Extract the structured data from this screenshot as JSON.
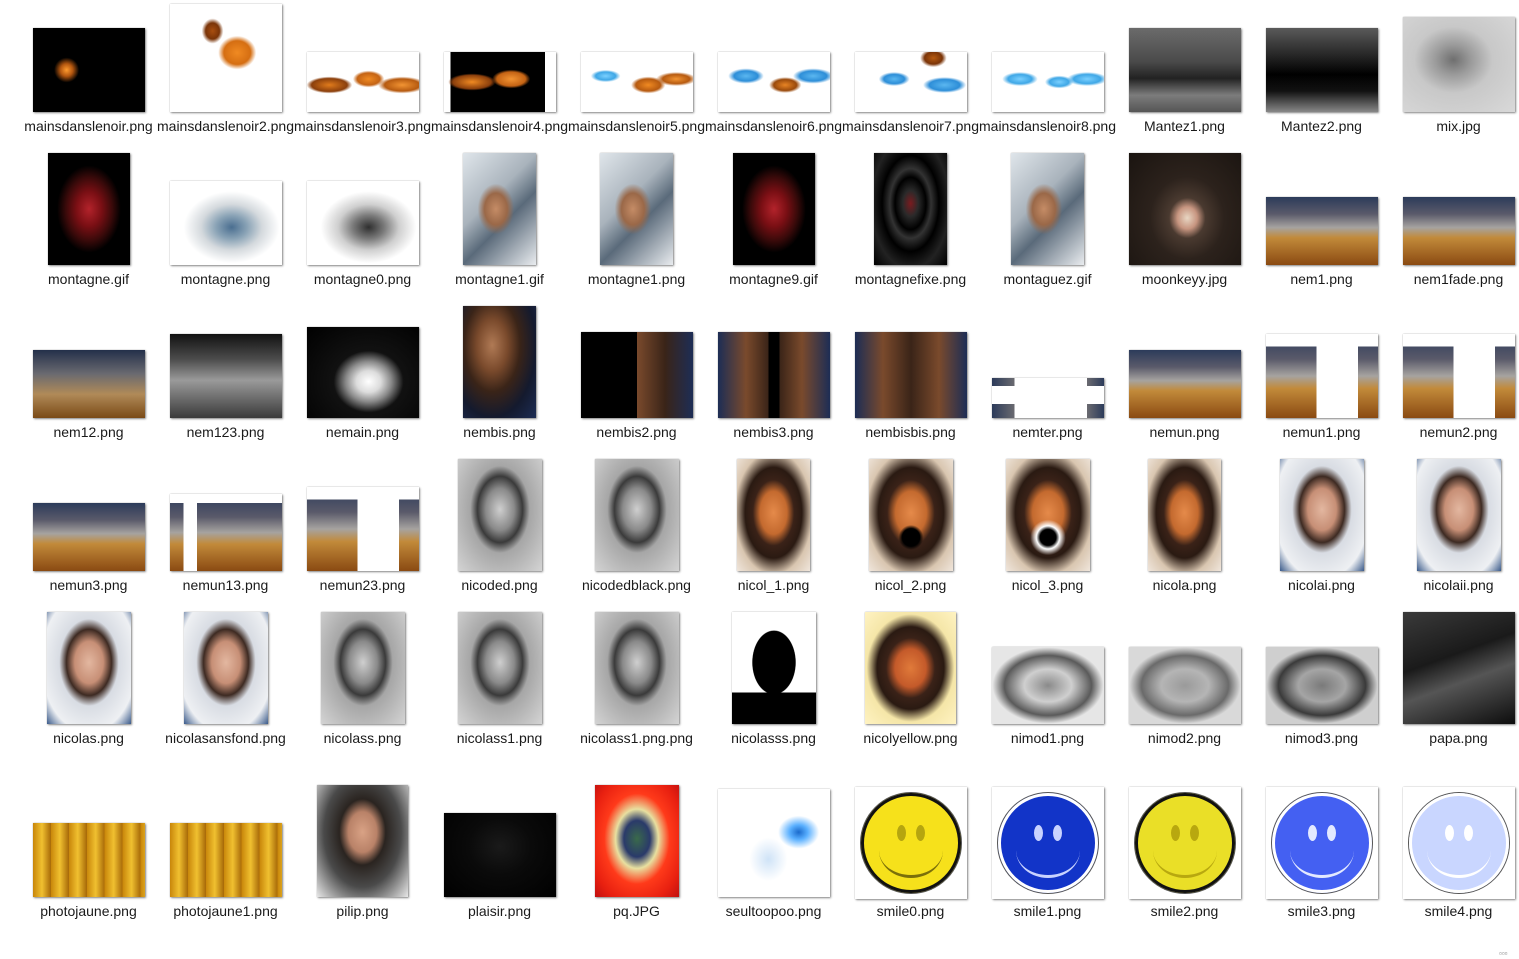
{
  "files": [
    {
      "name": "mainsdanslenoir.png",
      "thumb": "dark-hand"
    },
    {
      "name": "mainsdanslenoir2.png",
      "thumb": "orange-blob-white"
    },
    {
      "name": "mainsdanslenoir3.png",
      "thumb": "orange-hands-white"
    },
    {
      "name": "mainsdanslenoir4.png",
      "thumb": "orange-hands-black"
    },
    {
      "name": "mainsdanslenoir5.png",
      "thumb": "orange-blue-hands"
    },
    {
      "name": "mainsdanslenoir6.png",
      "thumb": "blue-hands"
    },
    {
      "name": "mainsdanslenoir7.png",
      "thumb": "blue-orange-hands"
    },
    {
      "name": "mainsdanslenoir8.png",
      "thumb": "blue-hands-light"
    },
    {
      "name": "Mantez1.png",
      "thumb": "gray-room"
    },
    {
      "name": "Mantez2.png",
      "thumb": "dark-room"
    },
    {
      "name": "mix.jpg",
      "thumb": "gray-mix"
    },
    {
      "name": "montagne.gif",
      "thumb": "heart"
    },
    {
      "name": "montagne.png",
      "thumb": "mountain"
    },
    {
      "name": "montagne0.png",
      "thumb": "mountain-gray"
    },
    {
      "name": "montagne1.gif",
      "thumb": "collage-figure"
    },
    {
      "name": "montagne1.png",
      "thumb": "collage-figure"
    },
    {
      "name": "montagne9.gif",
      "thumb": "heart"
    },
    {
      "name": "montagnefixe.png",
      "thumb": "dark-tunnel"
    },
    {
      "name": "montaguez.gif",
      "thumb": "collage-figure"
    },
    {
      "name": "moonkeyy.jpg",
      "thumb": "monkey"
    },
    {
      "name": "nem1.png",
      "thumb": "glass-table"
    },
    {
      "name": "nem1fade.png",
      "thumb": "glass-table"
    },
    {
      "name": "nem12.png",
      "thumb": "glass-table-blur"
    },
    {
      "name": "nem123.png",
      "thumb": "gray-blur"
    },
    {
      "name": "nemain.png",
      "thumb": "bw-hand"
    },
    {
      "name": "nembis.png",
      "thumb": "face-closeup"
    },
    {
      "name": "nembis2.png",
      "thumb": "face-half"
    },
    {
      "name": "nembis3.png",
      "thumb": "face-split"
    },
    {
      "name": "nembisbis.png",
      "thumb": "face-mirror"
    },
    {
      "name": "nemter.png",
      "thumb": "nemter"
    },
    {
      "name": "nemun.png",
      "thumb": "glass-table"
    },
    {
      "name": "nemun1.png",
      "thumb": "glass-table-rect"
    },
    {
      "name": "nemun2.png",
      "thumb": "glass-table-rect"
    },
    {
      "name": "nemun3.png",
      "thumb": "glass-table"
    },
    {
      "name": "nemun13.png",
      "thumb": "glass-table-cut"
    },
    {
      "name": "nemun23.png",
      "thumb": "glass-table-rect"
    },
    {
      "name": "nicoded.png",
      "thumb": "portrait-gray"
    },
    {
      "name": "nicodedblack.png",
      "thumb": "portrait-gray"
    },
    {
      "name": "nicol_1.png",
      "thumb": "portrait-orange"
    },
    {
      "name": "nicol_2.png",
      "thumb": "portrait-orange-mouth"
    },
    {
      "name": "nicol_3.png",
      "thumb": "portrait-orange-mouth2"
    },
    {
      "name": "nicola.png",
      "thumb": "portrait-orange"
    },
    {
      "name": "nicolai.png",
      "thumb": "portrait-color"
    },
    {
      "name": "nicolaii.png",
      "thumb": "portrait-color"
    },
    {
      "name": "nicolas.png",
      "thumb": "portrait-color"
    },
    {
      "name": "nicolasansfond.png",
      "thumb": "portrait-color"
    },
    {
      "name": "nicolass.png",
      "thumb": "portrait-gray"
    },
    {
      "name": "nicolass1.png",
      "thumb": "portrait-gray"
    },
    {
      "name": "nicolass1.png.png",
      "thumb": "portrait-gray"
    },
    {
      "name": "nicolasss.png",
      "thumb": "silhouette"
    },
    {
      "name": "nicolyellow.png",
      "thumb": "portrait-yellow"
    },
    {
      "name": "nimod1.png",
      "thumb": "face-noise"
    },
    {
      "name": "nimod2.png",
      "thumb": "face-noise2"
    },
    {
      "name": "nimod3.png",
      "thumb": "face-noise3"
    },
    {
      "name": "papa.png",
      "thumb": "dark-street"
    },
    {
      "name": "photojaune.png",
      "thumb": "yellow-chairs"
    },
    {
      "name": "photojaune1.png",
      "thumb": "yellow-chairs"
    },
    {
      "name": "pilip.png",
      "thumb": "portrait-hoodie"
    },
    {
      "name": "plaisir.png",
      "thumb": "black-building"
    },
    {
      "name": "pq.JPG",
      "thumb": "inverted-portrait"
    },
    {
      "name": "seultoopoo.png",
      "thumb": "blue-streak"
    },
    {
      "name": "smile0.png",
      "thumb": "smile-yellow"
    },
    {
      "name": "smile1.png",
      "thumb": "smile-blue"
    },
    {
      "name": "smile2.png",
      "thumb": "smile-yellow2"
    },
    {
      "name": "smile3.png",
      "thumb": "smile-blue2"
    },
    {
      "name": "smile4.png",
      "thumb": "smile-pale"
    }
  ]
}
